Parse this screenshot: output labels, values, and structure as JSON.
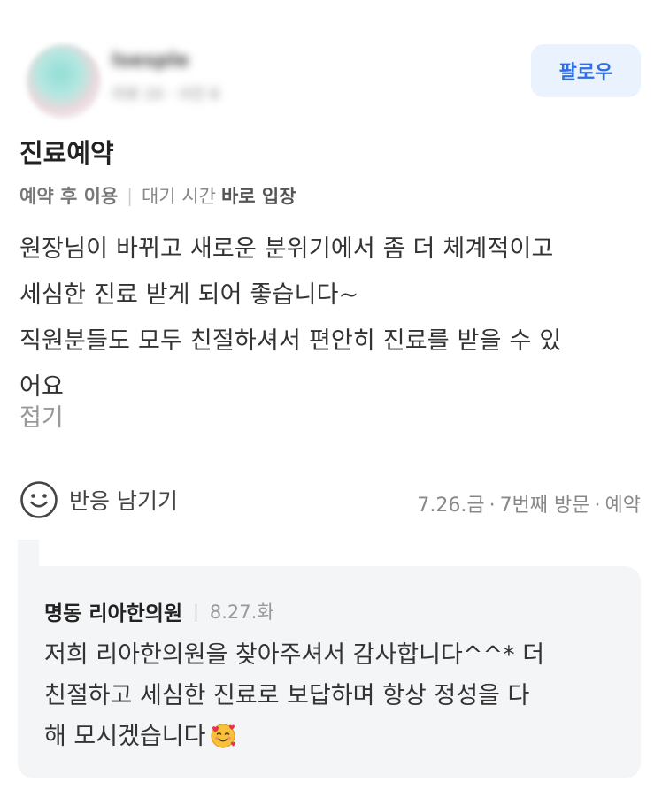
{
  "header": {
    "username": "Isesple",
    "meta": "리뷰 10 · 사진 6",
    "follow_label": "팔로우"
  },
  "review": {
    "title": "진료예약",
    "tag1": "예약 후 이용",
    "tag2_prefix": "대기 시간",
    "tag2_value": "바로 입장",
    "body_lines": [
      "원장님이 바뀌고 새로운 분위기에서 좀 더 체계적이고",
      "세심한 진료 받게 되어 좋습니다~",
      "직원분들도 모두 친절하셔서 편안히 진료를 받을 수 있",
      "어요"
    ],
    "fold_label": "접기"
  },
  "reaction": {
    "label": "반응 남기기",
    "date": "7.26.금",
    "visit": "7번째 방문",
    "type": "예약"
  },
  "owner_reply": {
    "name": "명동 리아한의원",
    "date": "8.27.화",
    "lines": [
      "저희 리아한의원을 찾아주셔서 감사합니다^^* 더",
      "친절하고 세심한 진료로 보답하며 항상 정성을 다",
      "해 모시겠습니다"
    ]
  }
}
